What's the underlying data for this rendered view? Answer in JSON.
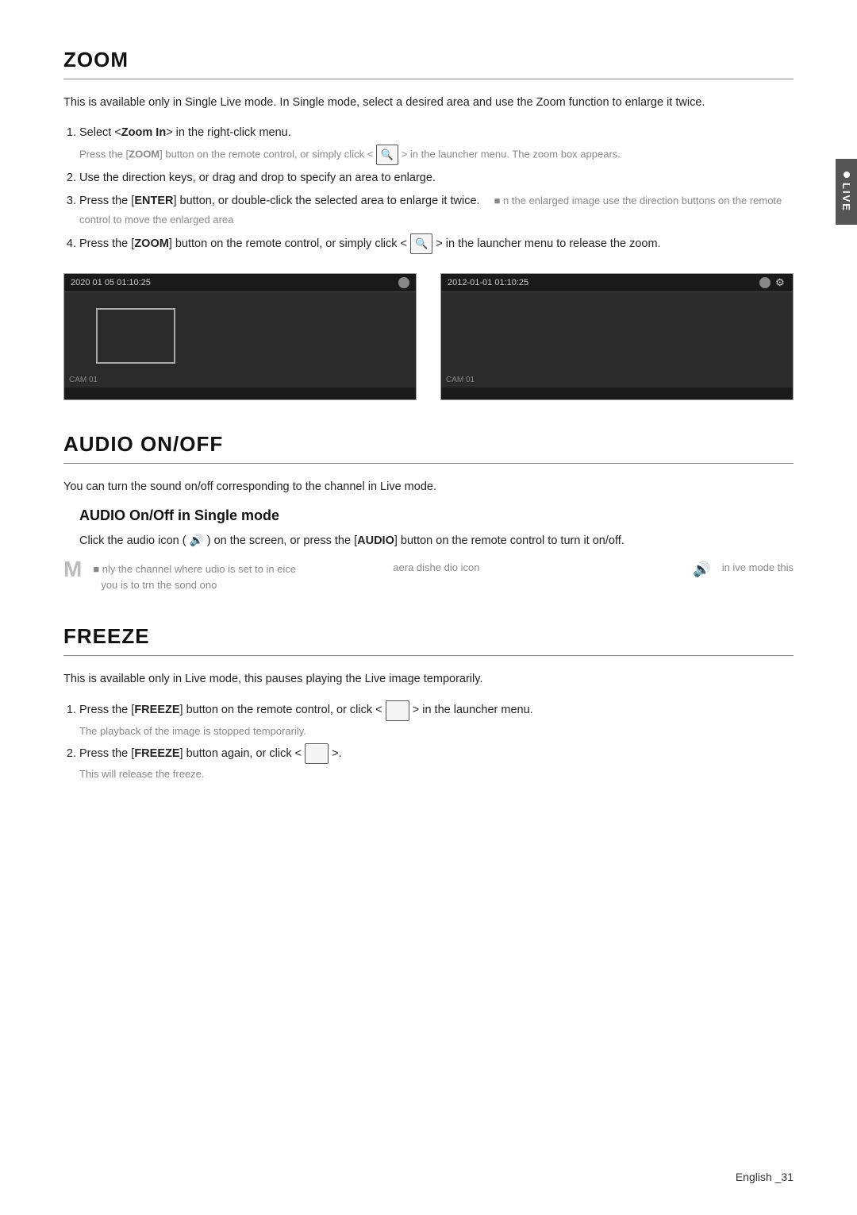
{
  "page": {
    "footer": "English _31"
  },
  "live_tab": {
    "label": "LIVE"
  },
  "zoom_section": {
    "title": "ZOOM",
    "intro": "This is available only in Single Live mode. In Single mode, select a desired area and use the Zoom function to enlarge it twice.",
    "steps": [
      {
        "text": "Select <Zoom In> in the right-click menu.",
        "note": "Press the [ZOOM] button on the remote control, or simply click <  > in the launcher menu. The zoom box appears."
      },
      {
        "text": "Use the direction keys, or drag and drop to specify an area to enlarge.",
        "note": ""
      },
      {
        "text": "Press the [ENTER] button, or double-click the selected area to enlarge it twice.",
        "note": "n the enlarged image use the direction buttons on the remote control to move the enlarged area"
      },
      {
        "text": "Press the [ZOOM] button on the remote control, or simply click <  > in the launcher menu to release the zoom.",
        "note": ""
      }
    ],
    "camera1": {
      "timestamp": "2020 01 05 01:10:25",
      "cam_label": "CAM 01"
    },
    "camera2": {
      "timestamp": "2012-01-01 01:10:25",
      "cam_label": "CAM 01"
    }
  },
  "audio_section": {
    "title": "AUDIO ON/OFF",
    "intro": "You can turn the sound on/off corresponding to the channel in Live mode.",
    "sub_title": "AUDIO On/Off in Single mode",
    "sub_intro": "Click the audio icon (  ) on the screen, or press the [AUDIO] button on the remote control to turn it on/off.",
    "note_text": "nly the channel where audio is set to in device area display the audio icon in live mode this place is to turn the sound on/off"
  },
  "freeze_section": {
    "title": "FREEZE",
    "intro": "This is available only in Live mode, this pauses playing the Live image temporarily.",
    "steps": [
      {
        "text": "Press the [FREEZE] button on the remote control, or click <      > in the launcher menu.",
        "note": "The playback of the image is stopped temporarily."
      },
      {
        "text": "Press the [FREEZE] button again, or click <      >.",
        "note": "This will release the freeze."
      }
    ]
  }
}
